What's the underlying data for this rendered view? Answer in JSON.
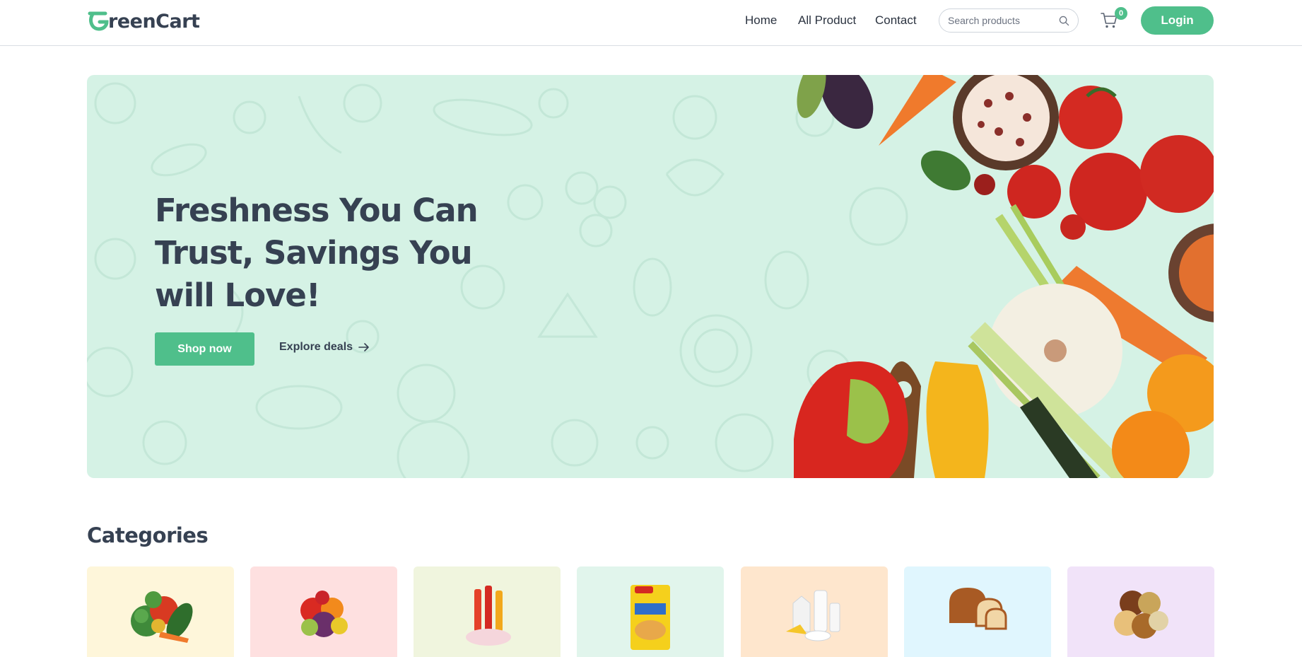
{
  "brand": {
    "name": "GreenCart",
    "accent": "#4fbf8b",
    "text_color": "#364152"
  },
  "nav": {
    "links": [
      "Home",
      "All Product",
      "Contact"
    ],
    "search_placeholder": "Search products",
    "cart_count": "0",
    "login_label": "Login"
  },
  "hero": {
    "title_lines": [
      "Freshness You Can",
      "Trust, Savings You",
      "will Love!"
    ],
    "shop_label": "Shop now",
    "explore_label": "Explore deals",
    "background": "#d5f2e5"
  },
  "categories": {
    "title": "Categories",
    "items": [
      {
        "icon": "vegetables-icon",
        "bg": "#fef6da"
      },
      {
        "icon": "fruits-icon",
        "bg": "#fee0e0"
      },
      {
        "icon": "drinks-icon",
        "bg": "#f0f5de"
      },
      {
        "icon": "instant-noodles-icon",
        "bg": "#e1f5ec"
      },
      {
        "icon": "dairy-icon",
        "bg": "#fee6cd"
      },
      {
        "icon": "bakery-icon",
        "bg": "#e0f6fe"
      },
      {
        "icon": "grains-icon",
        "bg": "#f1e3f9"
      }
    ]
  }
}
